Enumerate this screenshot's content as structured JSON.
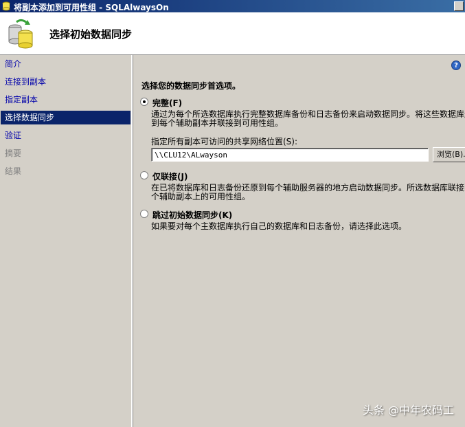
{
  "window": {
    "title": "将副本添加到可用性组 - SQLAlwaysOn"
  },
  "header": {
    "page_title": "选择初始数据同步"
  },
  "nav": {
    "items": [
      {
        "label": "简介"
      },
      {
        "label": "连接到副本"
      },
      {
        "label": "指定副本"
      },
      {
        "label": "选择数据同步"
      },
      {
        "label": "验证"
      },
      {
        "label": "摘要"
      },
      {
        "label": "结果"
      }
    ]
  },
  "content": {
    "heading": "选择您的数据同步首选项。",
    "options": [
      {
        "label": "完整(F)",
        "checked": true,
        "desc_line1": "通过为每个所选数据库执行完整数据库备份和日志备份来启动数据同步。将这些数据库还原",
        "desc_line2": "到每个辅助副本并联接到可用性组。"
      },
      {
        "label": "仅联接(J)",
        "checked": false,
        "desc_line1": "在已将数据库和日志备份还原到每个辅助服务器的地方启动数据同步。所选数据库联接到每",
        "desc_line2": "个辅助副本上的可用性组。"
      },
      {
        "label": "跳过初始数据同步(K)",
        "checked": false,
        "desc_line1": "如果要对每个主数据库执行自己的数据库和日志备份，请选择此选项。"
      }
    ],
    "share_label": "指定所有副本可访问的共享网络位置(S):",
    "share_value": "\\\\CLU12\\ALwayson",
    "browse_label": "浏览(B)..."
  },
  "watermark": "头条 @中年农码工",
  "colors": {
    "selection": "#0a246a",
    "link": "#0000aa",
    "panel": "#d4d0c8"
  }
}
